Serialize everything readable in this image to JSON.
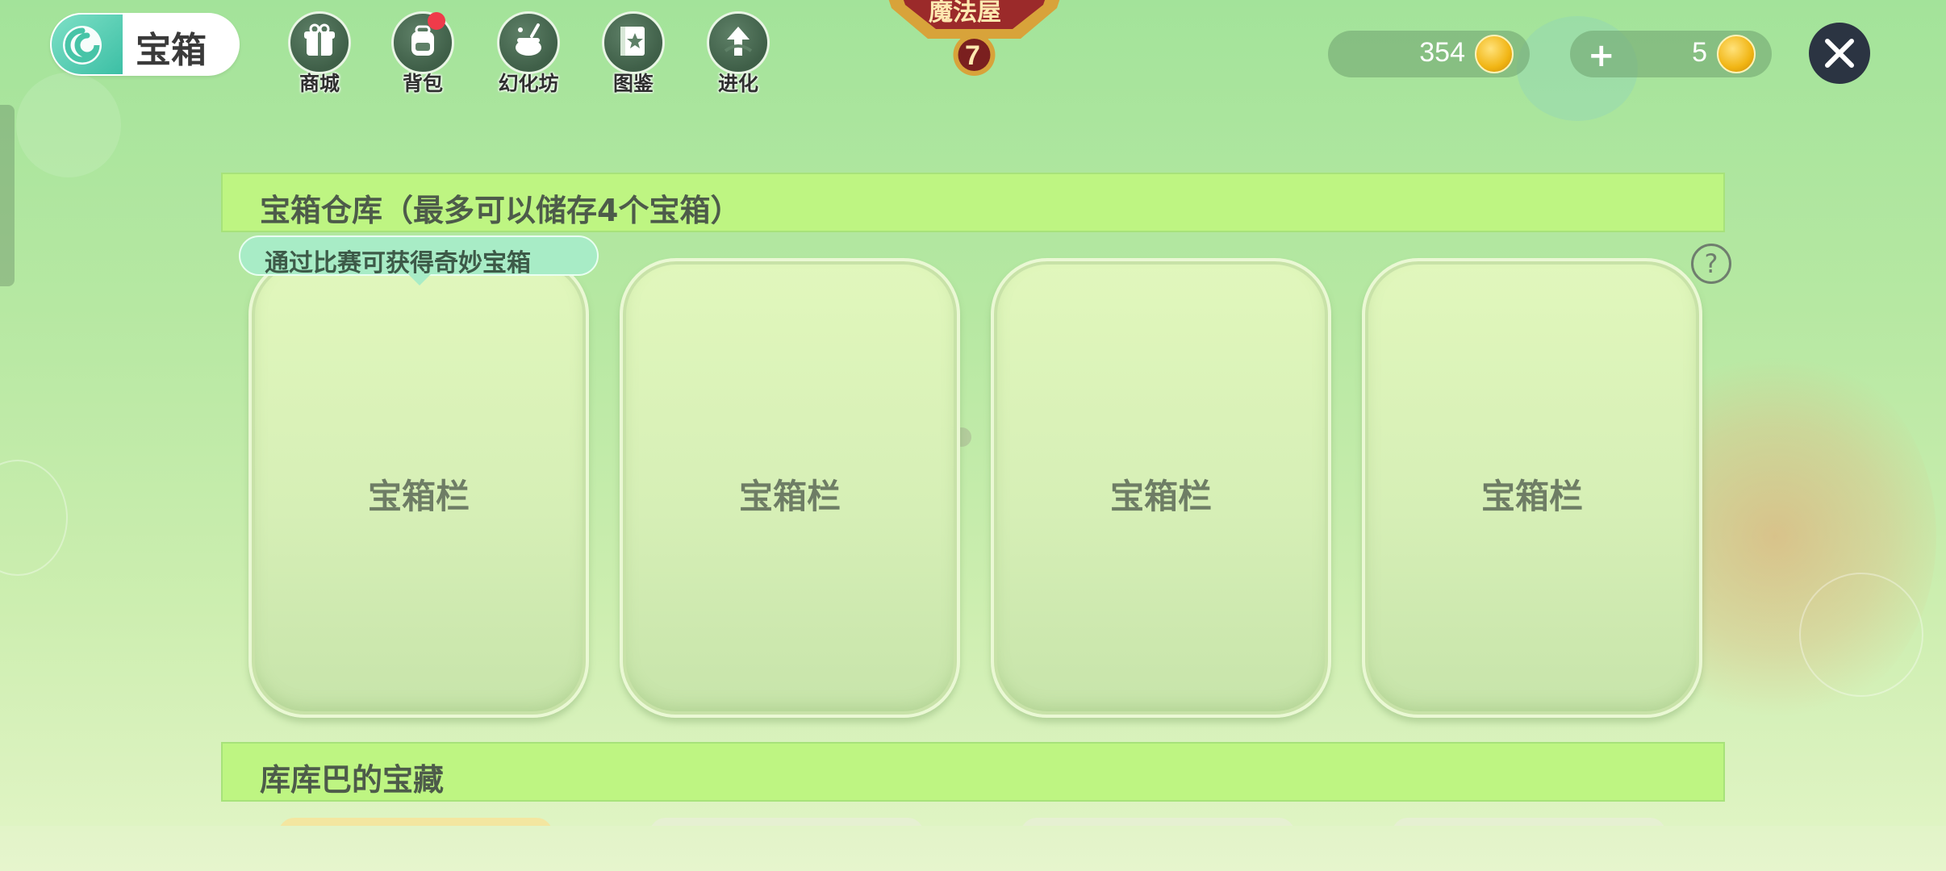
{
  "header": {
    "title": "宝箱",
    "logo_icon": "swirl-logo-icon"
  },
  "nav": {
    "items": [
      {
        "label": "商城",
        "icon": "shop-gift-icon",
        "has_notification": false
      },
      {
        "label": "背包",
        "icon": "backpack-icon",
        "has_notification": true
      },
      {
        "label": "幻化坊",
        "icon": "magic-pot-icon",
        "has_notification": false
      },
      {
        "label": "图鉴",
        "icon": "book-icon",
        "has_notification": false
      },
      {
        "label": "进化",
        "icon": "evolve-arrow-icon",
        "has_notification": false
      }
    ]
  },
  "badge": {
    "label": "魔法屋",
    "level": "7"
  },
  "currency": {
    "coins": "354",
    "premium": "5",
    "add_icon": "plus-icon",
    "coin_icon": "coin-icon"
  },
  "close_icon": "close-icon",
  "storage_section": {
    "title": "宝箱仓库（最多可以储存4个宝箱）",
    "tip": "通过比赛可获得奇妙宝箱",
    "help_symbol": "?",
    "slots": [
      {
        "label": "宝箱栏"
      },
      {
        "label": "宝箱栏"
      },
      {
        "label": "宝箱栏"
      },
      {
        "label": "宝箱栏"
      }
    ]
  },
  "treasure_section": {
    "title": "库库巴的宝藏"
  },
  "colors": {
    "section_header_bg": "#bef582",
    "tip_bg": "#a8ecc6",
    "notification_dot": "#ef3b4a",
    "close_button_bg": "#2b3442"
  }
}
